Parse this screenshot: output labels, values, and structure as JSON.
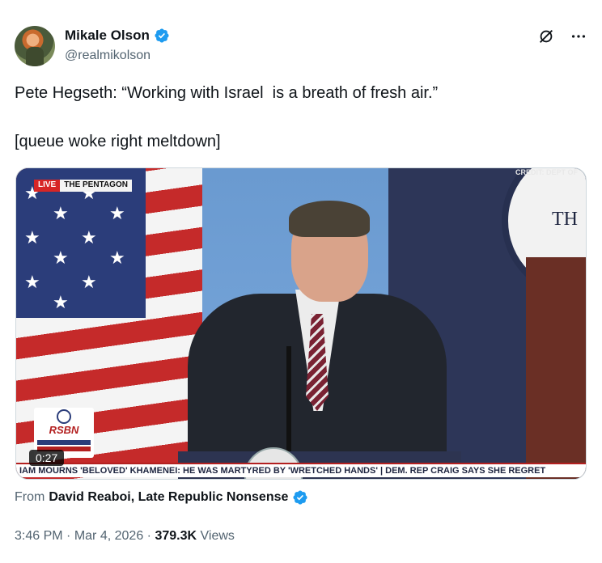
{
  "author": {
    "display_name": "Mikale Olson",
    "handle": "@realmikolson"
  },
  "actions": {
    "grok_icon": "grok-icon",
    "more_icon": "more-icon"
  },
  "tweet": {
    "text": "Pete Hegseth: “Working with Israel  is a breath of fresh air.”\n\n[queue woke right meltdown]"
  },
  "media": {
    "live_label": "LIVE",
    "location_label": "THE PENTAGON",
    "credit": "CREDIT: DEPT OF",
    "seal_text": "TH",
    "rsbn_label": "RSBN",
    "ticker": "IAM MOURNS 'BELOVED' KHAMENEI: HE WAS MARTYRED BY 'WRETCHED HANDS'  |  DEM. REP CRAIG SAYS SHE REGRET",
    "duration": "0:27"
  },
  "source": {
    "prefix": "From",
    "name": "David Reaboi, Late Republic Nonsense"
  },
  "meta": {
    "time": "3:46 PM",
    "separator": "·",
    "date": "Mar 4, 2026",
    "views_count": "379.3K",
    "views_label": "Views"
  },
  "colors": {
    "verified": "#1d9bf0",
    "secondary_text": "#536471",
    "primary_text": "#0f1419"
  }
}
